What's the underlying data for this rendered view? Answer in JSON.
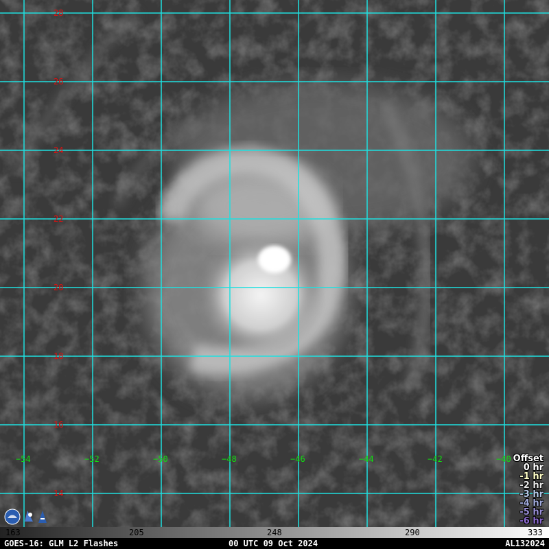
{
  "map": {
    "latitudes": [
      {
        "label": "28",
        "value": 28
      },
      {
        "label": "26",
        "value": 26
      },
      {
        "label": "24",
        "value": 24
      },
      {
        "label": "22",
        "value": 22
      },
      {
        "label": "20",
        "value": 20
      },
      {
        "label": "18",
        "value": 18
      },
      {
        "label": "16",
        "value": 16
      },
      {
        "label": "14",
        "value": 14
      }
    ],
    "longitudes": [
      {
        "label": "−54",
        "value": -54
      },
      {
        "label": "−52",
        "value": -52
      },
      {
        "label": "−50",
        "value": -50
      },
      {
        "label": "−48",
        "value": -48
      },
      {
        "label": "−46",
        "value": -46
      },
      {
        "label": "−44",
        "value": -44
      },
      {
        "label": "−42",
        "value": -42
      },
      {
        "label": "−40",
        "value": -40
      }
    ],
    "grid_color": "#1ee0e0",
    "lat_label_color": "#e01010",
    "lon_label_color": "#10e010"
  },
  "legend": {
    "title": "Offset",
    "entries": [
      {
        "label": "0 hr",
        "color": "#ffffff"
      },
      {
        "label": "-1 hr",
        "color": "#ffffc8"
      },
      {
        "label": "-2 hr",
        "color": "#e6e6e6"
      },
      {
        "label": "-3 hr",
        "color": "#b4c8e6"
      },
      {
        "label": "-4 hr",
        "color": "#a0aadc"
      },
      {
        "label": "-5 hr",
        "color": "#9a8fd8"
      },
      {
        "label": "-6 hr",
        "color": "#8c6ad0"
      }
    ]
  },
  "colorbar": {
    "ticks": [
      "163",
      "205",
      "248",
      "290",
      "333"
    ]
  },
  "footer": {
    "left": "GOES-16: GLM L2 Flashes",
    "center": "00 UTC 09 Oct 2024",
    "right": "AL132024"
  },
  "logos": {
    "icons": [
      "noaa-globe-icon",
      "satellite-icon"
    ]
  }
}
